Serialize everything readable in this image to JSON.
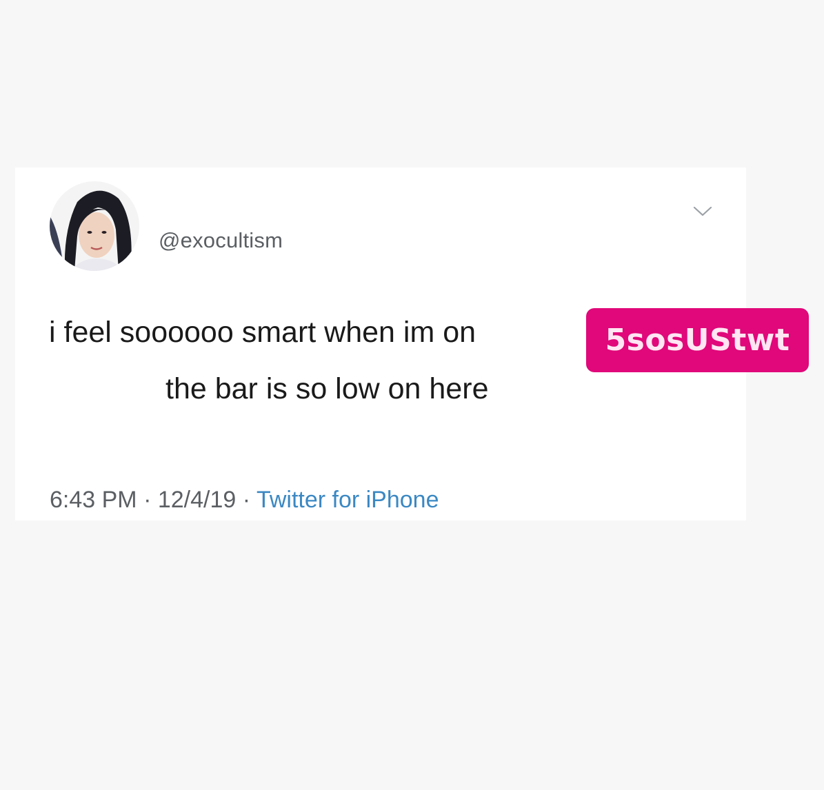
{
  "tweet": {
    "handle": "@exocultism",
    "text_line1": "i feel soooooo smart when im on",
    "text_line2": "the bar is so low on here",
    "time": "6:43 PM",
    "separator": "·",
    "date": "12/4/19",
    "source": "Twitter for iPhone",
    "caret_icon": "chevron-down-icon"
  },
  "sticker": {
    "label": "5sosUStwt",
    "color": "#e0087a"
  },
  "colors": {
    "background": "#f7f7f7",
    "card": "#ffffff",
    "text": "#1a1a1a",
    "muted": "#5b5f63",
    "link": "#3b88c3"
  }
}
